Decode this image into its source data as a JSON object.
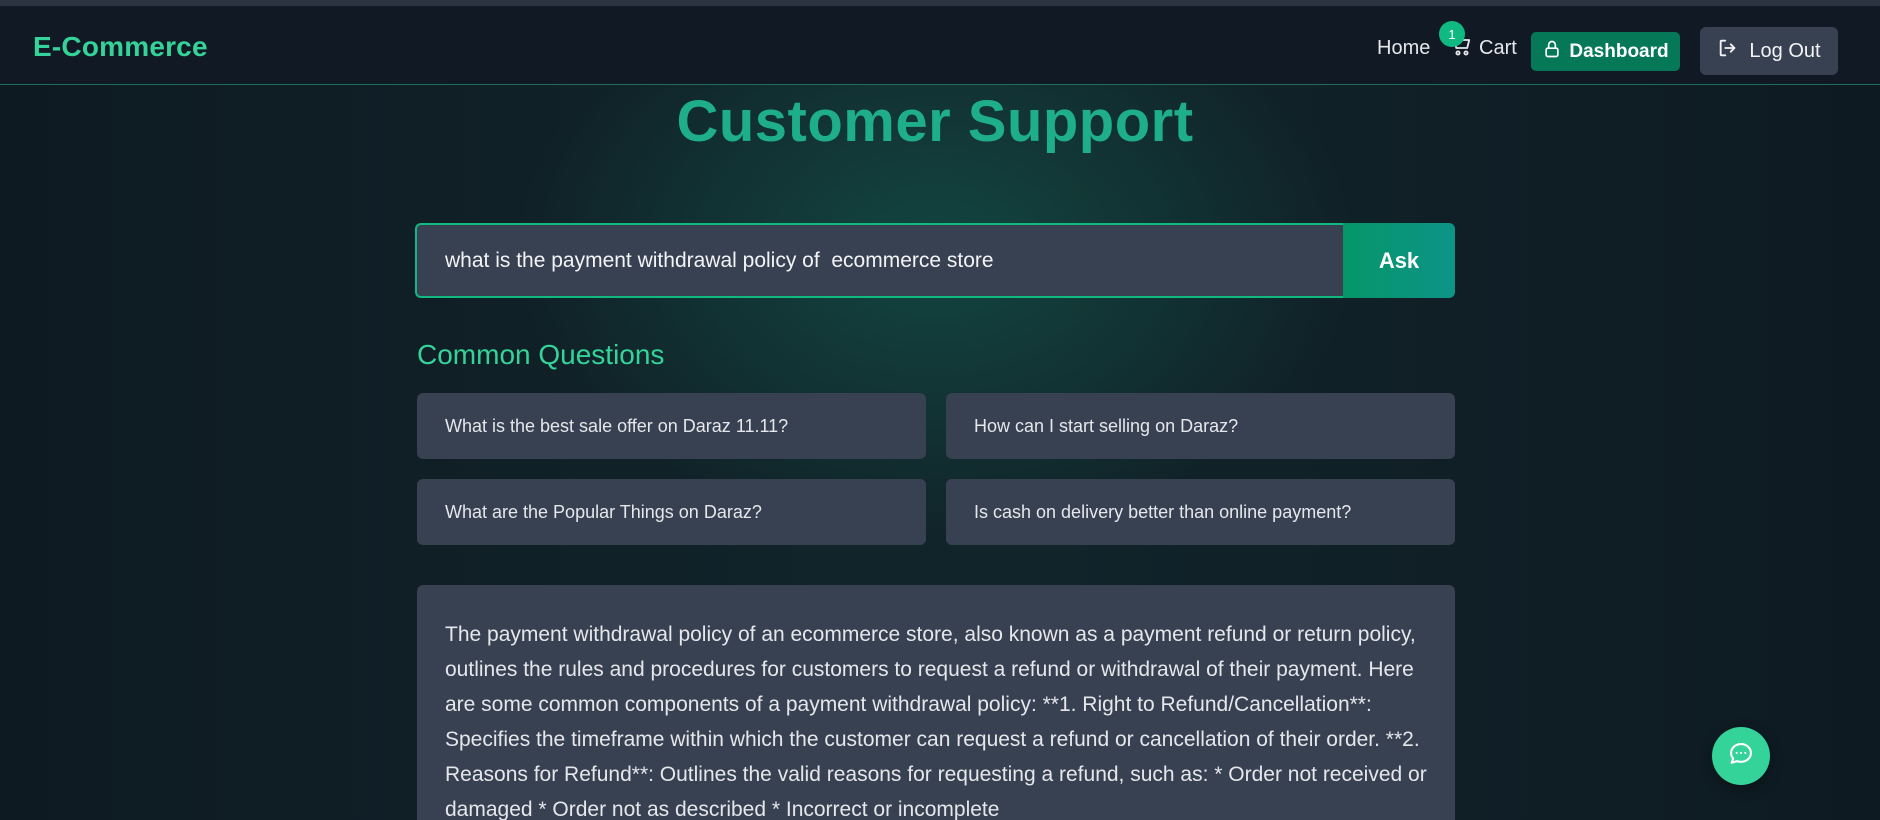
{
  "navbar": {
    "brand": "E-Commerce",
    "home_label": "Home",
    "cart_label": "Cart",
    "cart_count": "1",
    "dashboard_label": "Dashboard",
    "logout_label": "Log Out"
  },
  "page": {
    "title": "Customer Support"
  },
  "search": {
    "value": "what is the payment withdrawal policy of  ecommerce store",
    "button_label": "Ask"
  },
  "common_questions": {
    "title": "Common Questions",
    "items": [
      "What is the best sale offer on Daraz 11.11?",
      "How can I start selling on Daraz?",
      "What are the Popular Things on Daraz?",
      "Is cash on delivery better than online payment?"
    ]
  },
  "answer": {
    "text": "The payment withdrawal policy of an ecommerce store, also known as a payment refund or return policy, outlines the rules and procedures for customers to request a refund or withdrawal of their payment. Here are some common components of a payment withdrawal policy: **1. Right to Refund/Cancellation**: Specifies the timeframe within which the customer can request a refund or cancellation of their order. **2. Reasons for Refund**: Outlines the valid reasons for requesting a refund, such as: * Order not received or damaged * Order not as described * Incorrect or incomplete"
  },
  "icons": {
    "cart": "cart-icon",
    "dashboard": "lock-icon",
    "logout": "logout-icon",
    "chat": "chat-icon"
  },
  "colors": {
    "accent": "#34d399",
    "title": "#1fae8a",
    "dashboard_bg": "#047857",
    "card_bg": "#374151"
  }
}
